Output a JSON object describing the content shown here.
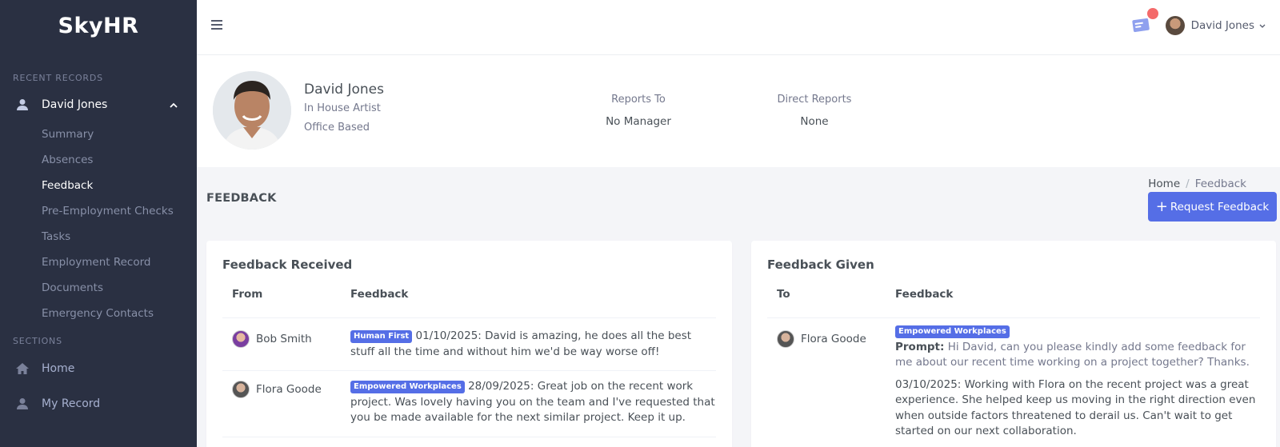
{
  "app": {
    "brand": "SkyHR"
  },
  "sidebar": {
    "recent_title": "RECENT RECORDS",
    "record_name": "David Jones",
    "sub_items": [
      {
        "label": "Summary",
        "active": false
      },
      {
        "label": "Absences",
        "active": false
      },
      {
        "label": "Feedback",
        "active": true
      },
      {
        "label": "Pre-Employment Checks",
        "active": false
      },
      {
        "label": "Tasks",
        "active": false
      },
      {
        "label": "Employment Record",
        "active": false
      },
      {
        "label": "Documents",
        "active": false
      },
      {
        "label": "Emergency Contacts",
        "active": false
      }
    ],
    "sections_title": "SECTIONS",
    "sections": [
      {
        "label": "Home",
        "icon": "home-icon"
      },
      {
        "label": "My Record",
        "icon": "user-icon"
      }
    ]
  },
  "topbar": {
    "user_name": "David Jones"
  },
  "profile": {
    "name": "David Jones",
    "role": "In House Artist",
    "location": "Office Based",
    "reports_to_label": "Reports To",
    "reports_to_value": "No Manager",
    "direct_reports_label": "Direct Reports",
    "direct_reports_value": "None"
  },
  "page": {
    "title": "FEEDBACK",
    "breadcrumb_home": "Home",
    "breadcrumb_sep": "/",
    "breadcrumb_current": "Feedback",
    "request_button": "Request Feedback"
  },
  "received": {
    "title": "Feedback Received",
    "col_from": "From",
    "col_feedback": "Feedback",
    "rows": [
      {
        "person": "Bob Smith",
        "badge": "Human First",
        "text": "01/10/2025: David is amazing, he does all the best stuff all the time and without him we'd be way worse off!"
      },
      {
        "person": "Flora Goode",
        "badge": "Empowered Workplaces",
        "text": "28/09/2025: Great job on the recent work project. Was lovely having you on the team and I've requested that you be made available for the next similar project. Keep it up."
      }
    ]
  },
  "given": {
    "title": "Feedback Given",
    "col_to": "To",
    "col_feedback": "Feedback",
    "rows": [
      {
        "person": "Flora Goode",
        "badge": "Empowered Workplaces",
        "prompt_label": "Prompt:",
        "prompt_text": "Hi David, can you please kindly add some feedback for me about our recent time working on a project together? Thanks.",
        "text": "03/10/2025: Working with Flora on the recent project was a great experience. She helped keep us moving in the right direction even when outside factors threatened to derail us. Can't wait to get started on our next collaboration."
      }
    ]
  },
  "colors": {
    "sidebar_bg": "#2a3042",
    "accent": "#556ee6",
    "notification": "#f46a6a"
  }
}
